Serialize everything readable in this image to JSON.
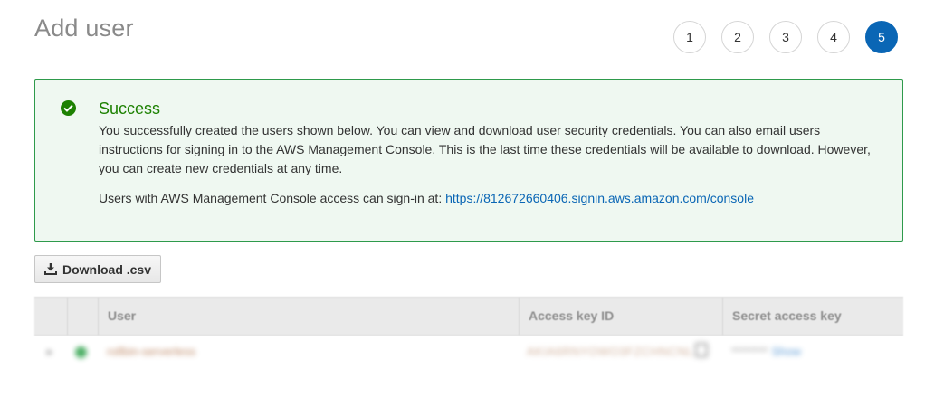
{
  "page": {
    "title": "Add user"
  },
  "steps": [
    "1",
    "2",
    "3",
    "4",
    "5"
  ],
  "success": {
    "title": "Success",
    "message": "You successfully created the users shown below. You can view and download user security credentials. You can also email users instructions for signing in to the AWS Management Console. This is the last time these credentials will be available to download. However, you can create new credentials at any time.",
    "signin_prefix": "Users with AWS Management Console access can sign-in at: ",
    "signin_url": "https://812672660406.signin.aws.amazon.com/console"
  },
  "toolbar": {
    "download_label": "Download .csv"
  },
  "table": {
    "columns": {
      "user": "User",
      "access_key_id": "Access key ID",
      "secret_access_key": "Secret access key"
    },
    "rows": [
      {
        "user": "rollbin-serverless",
        "access_key_id": "AKIA6RNYOWO3FZCHNCNL",
        "secret_mask": "********",
        "show_label": "Show"
      }
    ]
  },
  "colors": {
    "accent": "#0a66b5",
    "success": "#1d8102",
    "success_bg": "#eff8f1",
    "success_border": "#2e9a4b"
  }
}
